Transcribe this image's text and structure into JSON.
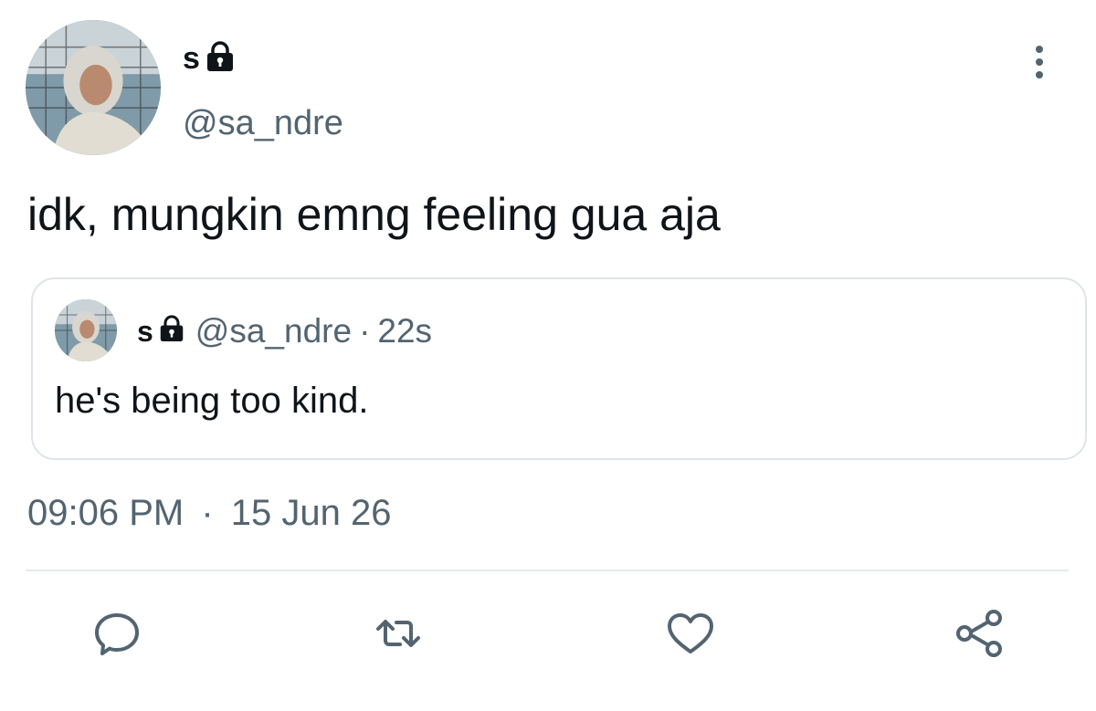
{
  "tweet": {
    "display_name": "s",
    "handle": "@sa_ndre",
    "text": "idk, mungkin emng feeling gua aja",
    "time": "09:06 PM",
    "separator": "·",
    "date": "15 Jun 26"
  },
  "quoted_tweet": {
    "display_name": "s",
    "handle": "@sa_ndre",
    "separator": "·",
    "age": "22s",
    "text": "he's being too kind."
  },
  "icons": {
    "lock": "lock-icon",
    "more": "more-vertical-icon",
    "reply": "reply-icon",
    "retweet": "retweet-icon",
    "like": "heart-icon",
    "share": "share-icon"
  },
  "colors": {
    "text": "#0f1419",
    "secondary": "#536471",
    "border": "#dfe4e8"
  }
}
